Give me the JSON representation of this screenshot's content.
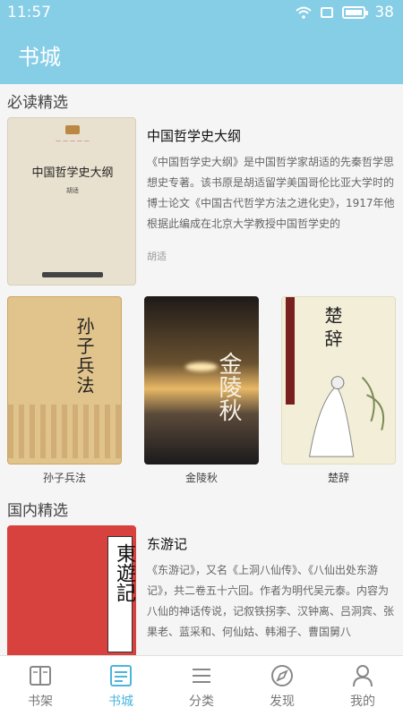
{
  "status": {
    "time": "11:57",
    "battery": "38"
  },
  "header": {
    "title": "书城"
  },
  "sections": [
    {
      "title": "必读精选"
    },
    {
      "title": "国内精选"
    }
  ],
  "featured": {
    "title": "中国哲学史大纲",
    "desc": "《中国哲学史大纲》是中国哲学家胡适的先秦哲学思想史专著。该书原是胡适留学美国哥伦比亚大学时的博士论文《中国古代哲学方法之进化史》，1917年他根据此编成在北京大学教授中国哲学史的",
    "author": "胡适",
    "cover_title": "中国哲学史大纲"
  },
  "grid": [
    {
      "label": "孙子兵法",
      "cover_title": "孙子兵法"
    },
    {
      "label": "金陵秋",
      "cover_title": "金陵秋"
    },
    {
      "label": "楚辞",
      "cover_title": "楚辞"
    }
  ],
  "featured2": {
    "title": "东游记",
    "desc": "《东游记》，又名《上洞八仙传》、《八仙出处东游记》，共二卷五十六回。作者为明代吴元泰。内容为八仙的神话传说，记叙铁拐李、汉钟离、吕洞宾、张果老、蓝采和、何仙姑、韩湘子、曹国舅八",
    "cover_title": "東遊記"
  },
  "tabs": [
    {
      "label": "书架",
      "icon": "book-icon"
    },
    {
      "label": "书城",
      "icon": "store-icon"
    },
    {
      "label": "分类",
      "icon": "list-icon"
    },
    {
      "label": "发现",
      "icon": "compass-icon"
    },
    {
      "label": "我的",
      "icon": "person-icon"
    }
  ],
  "colors": {
    "primary": "#86cde6",
    "active_tab": "#4bb5dd"
  }
}
